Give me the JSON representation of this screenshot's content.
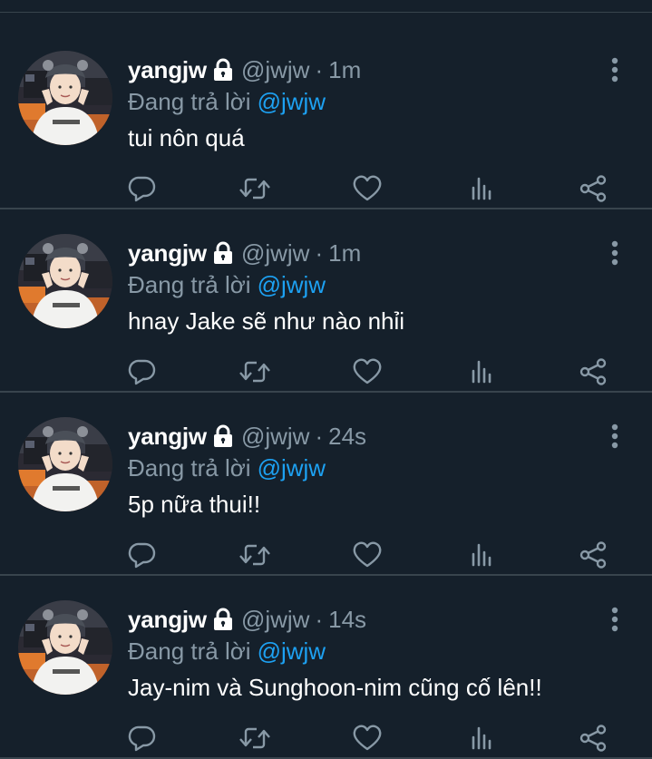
{
  "colors": {
    "background": "#15202b",
    "divider": "#38444d",
    "muted": "#8899a6",
    "link": "#1da1f2",
    "text": "#ffffff"
  },
  "icons": {
    "lock": "lock-icon",
    "more": "more-vertical-icon",
    "reply": "reply-icon",
    "retweet": "retweet-icon",
    "like": "heart-icon",
    "stats": "stats-icon",
    "share": "share-icon"
  },
  "tweets": [
    {
      "name": "yangjw",
      "handle": "@jwjw",
      "separator": "·",
      "time": "1m",
      "reply_prefix": "Đang trả lời",
      "reply_to": "@jwjw",
      "text": "tui nôn quá"
    },
    {
      "name": "yangjw",
      "handle": "@jwjw",
      "separator": "·",
      "time": "1m",
      "reply_prefix": "Đang trả lời",
      "reply_to": "@jwjw",
      "text": "hnay Jake sẽ như nào nhỉi"
    },
    {
      "name": "yangjw",
      "handle": "@jwjw",
      "separator": "·",
      "time": "24s",
      "reply_prefix": "Đang trả lời",
      "reply_to": "@jwjw",
      "text": "5p nữa thui!!"
    },
    {
      "name": "yangjw",
      "handle": "@jwjw",
      "separator": "·",
      "time": "14s",
      "reply_prefix": "Đang trả lời",
      "reply_to": "@jwjw",
      "text": "Jay-nim và Sunghoon-nim cũng cố lên!!"
    }
  ]
}
